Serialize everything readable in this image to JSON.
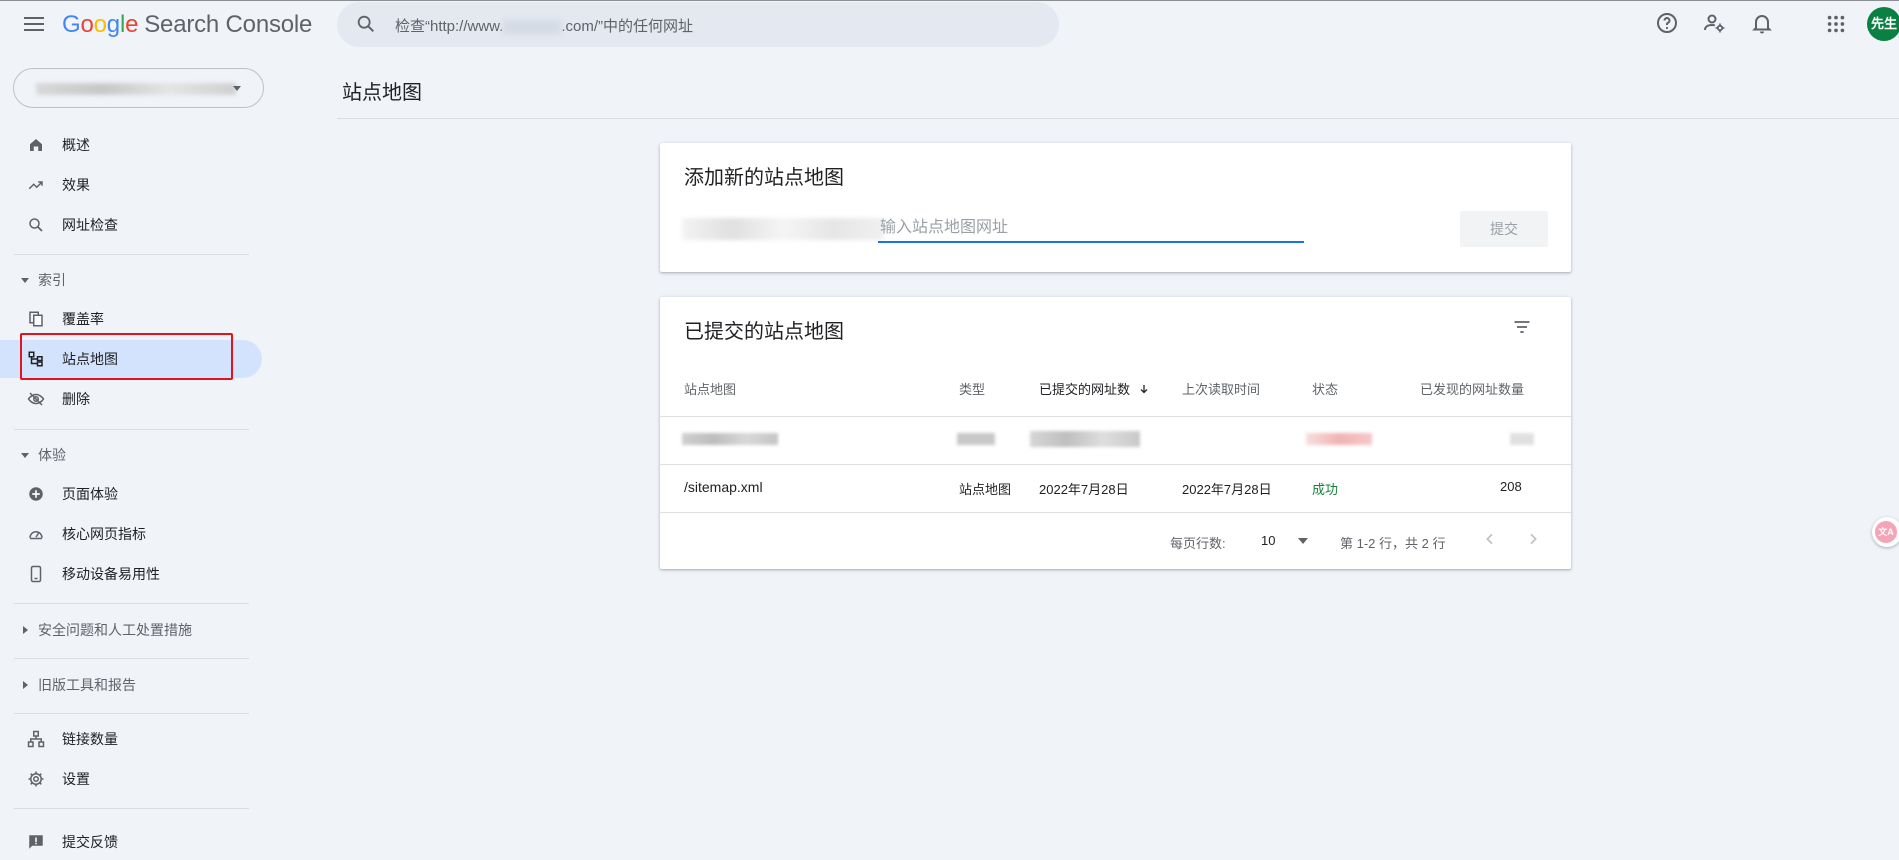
{
  "header": {
    "logo_google_letters": [
      "G",
      "o",
      "o",
      "g",
      "l",
      "e"
    ],
    "logo_rest": "Search Console",
    "search_placeholder_prefix": "检查“http://www.",
    "search_placeholder_suffix": ".com/”中的任何网址",
    "avatar_text": "先生",
    "icons": [
      "menu-icon",
      "search-icon",
      "help-icon",
      "manage-accounts-icon",
      "notifications-icon",
      "apps-icon"
    ]
  },
  "sidebar": {
    "items_top": [
      {
        "label": "概述",
        "icon": "home-icon"
      },
      {
        "label": "效果",
        "icon": "trending-up-icon"
      },
      {
        "label": "网址检查",
        "icon": "search-icon"
      }
    ],
    "section_index": "索引",
    "items_index": [
      {
        "label": "覆盖率",
        "icon": "copy-icon"
      },
      {
        "label": "站点地图",
        "icon": "sitemap-icon"
      },
      {
        "label": "删除",
        "icon": "visibility-off-icon"
      }
    ],
    "section_experience": "体验",
    "items_experience": [
      {
        "label": "页面体验",
        "icon": "add-circle-icon"
      },
      {
        "label": "核心网页指标",
        "icon": "speed-icon"
      },
      {
        "label": "移动设备易用性",
        "icon": "smartphone-icon"
      }
    ],
    "section_security": "安全问题和人工处置措施",
    "section_legacy": "旧版工具和报告",
    "items_bottom": [
      {
        "label": "链接数量",
        "icon": "links-icon"
      },
      {
        "label": "设置",
        "icon": "gear-icon"
      }
    ],
    "feedback": {
      "label": "提交反馈",
      "icon": "feedback-icon"
    }
  },
  "page": {
    "title": "站点地图"
  },
  "add_card": {
    "title": "添加新的站点地图",
    "input_placeholder": "输入站点地图网址",
    "submit_label": "提交"
  },
  "submitted_card": {
    "title": "已提交的站点地图",
    "columns": [
      "站点地图",
      "类型",
      "已提交的网址数",
      "上次读取时间",
      "状态",
      "已发现的网址数量"
    ],
    "rows": [
      {
        "sitemap": "/sitemap.xml",
        "type": "站点地图",
        "submitted": "2022年7月28日",
        "last_read": "2022年7月28日",
        "status": "成功",
        "discovered": "208"
      }
    ],
    "pager": {
      "rows_per_page_label": "每页行数:",
      "rows_per_page_value": "10",
      "range_text": "第 1-2 行，共 2 行"
    }
  },
  "colors": {
    "accent": "#1a73e8",
    "active_nav": "#d3e3fd",
    "success": "#188038",
    "highlight_box": "#e2131b",
    "background": "#f0f4f9"
  }
}
